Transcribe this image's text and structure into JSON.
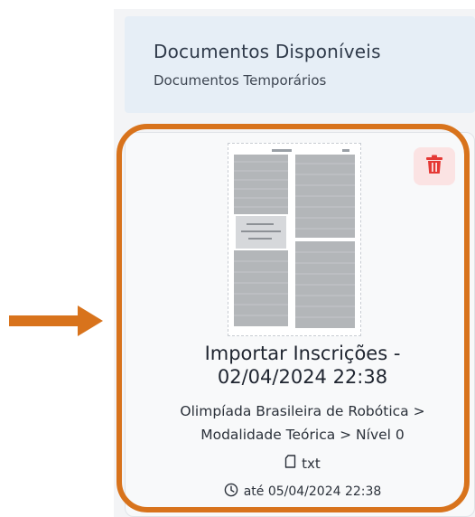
{
  "header": {
    "title": "Documentos Disponíveis",
    "subtitle": "Documentos Temporários"
  },
  "document": {
    "title_line1": "Importar Inscrições -",
    "title_line2": "02/04/2024 22:38",
    "path_line1": "Olimpíada Brasileira de Robótica >",
    "path_line2": "Modalidade Teórica > Nível 0",
    "file_type": "txt",
    "expiry": "até 05/04/2024 22:38",
    "icons": {
      "delete": "trash-icon",
      "file": "file-icon",
      "clock": "clock-icon"
    }
  },
  "colors": {
    "highlight": "#d8731c",
    "delete_bg": "#fbe3e3",
    "delete_icon": "#e53935",
    "header_bg": "#e6eef6"
  }
}
